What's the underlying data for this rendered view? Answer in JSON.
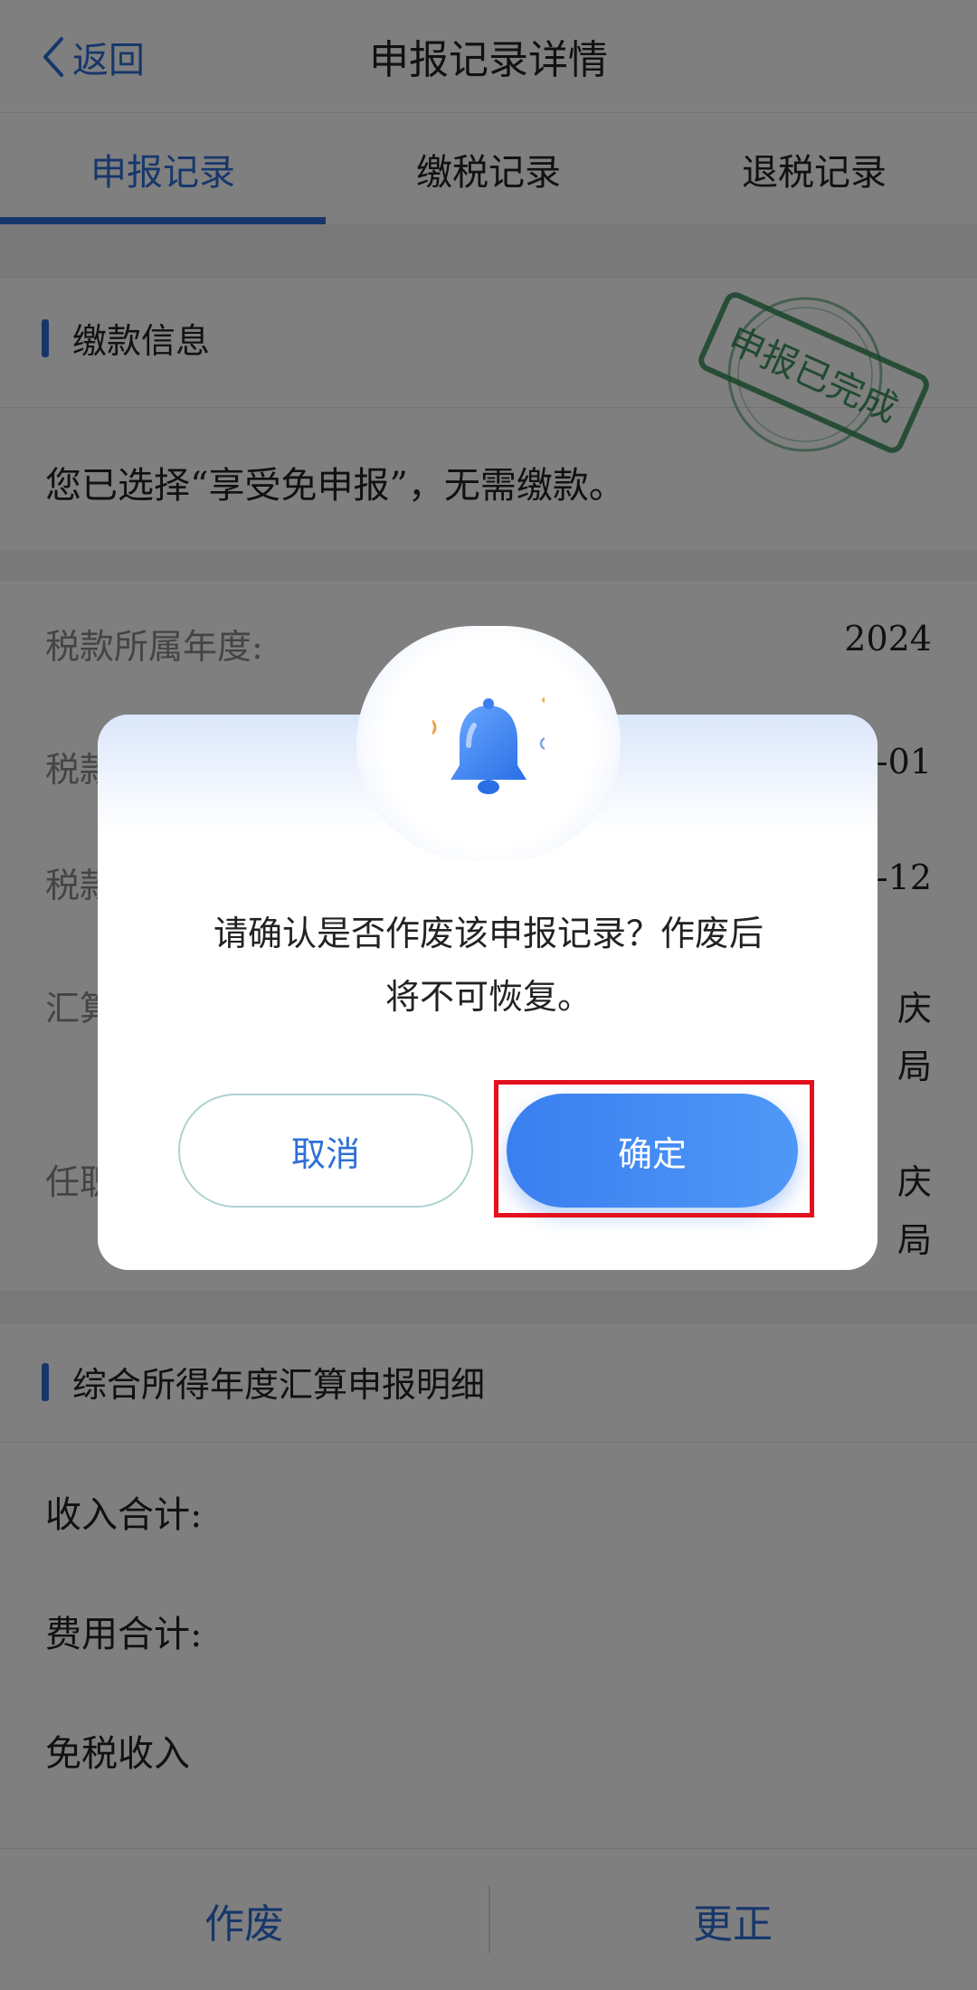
{
  "navbar": {
    "back_label": "返回",
    "title": "申报记录详情"
  },
  "tabs": [
    {
      "label": "申报记录",
      "active": true
    },
    {
      "label": "缴税记录",
      "active": false
    },
    {
      "label": "退税记录",
      "active": false
    }
  ],
  "payment": {
    "title": "缴款信息",
    "notice": "您已选择“享受免申报”，无需缴款。",
    "stamp_text": "申报已完成"
  },
  "details": {
    "rows": [
      {
        "label": "税款所属年度:",
        "value": "2024"
      },
      {
        "label": "税款",
        "value": "-01"
      },
      {
        "label": "税款",
        "value": "-12"
      },
      {
        "label": "汇算",
        "value_lines": [
          "庆",
          "局"
        ]
      },
      {
        "label": "任职",
        "value_lines": [
          "庆",
          "局"
        ]
      }
    ]
  },
  "summary": {
    "title": "综合所得年度汇算申报明细",
    "rows": [
      "收入合计:",
      "费用合计:",
      "免税收入"
    ]
  },
  "bottom_bar": {
    "void_label": "作废",
    "correct_label": "更正"
  },
  "dialog": {
    "message_line1": "请确认是否作废该申报记录？作废后",
    "message_line2": "将不可恢复。",
    "cancel_label": "取消",
    "confirm_label": "确定"
  },
  "colors": {
    "accent": "#2f6fd6",
    "confirm": "#3a7ff0",
    "highlight": "#e3101e",
    "stamp": "#2f8a52"
  }
}
